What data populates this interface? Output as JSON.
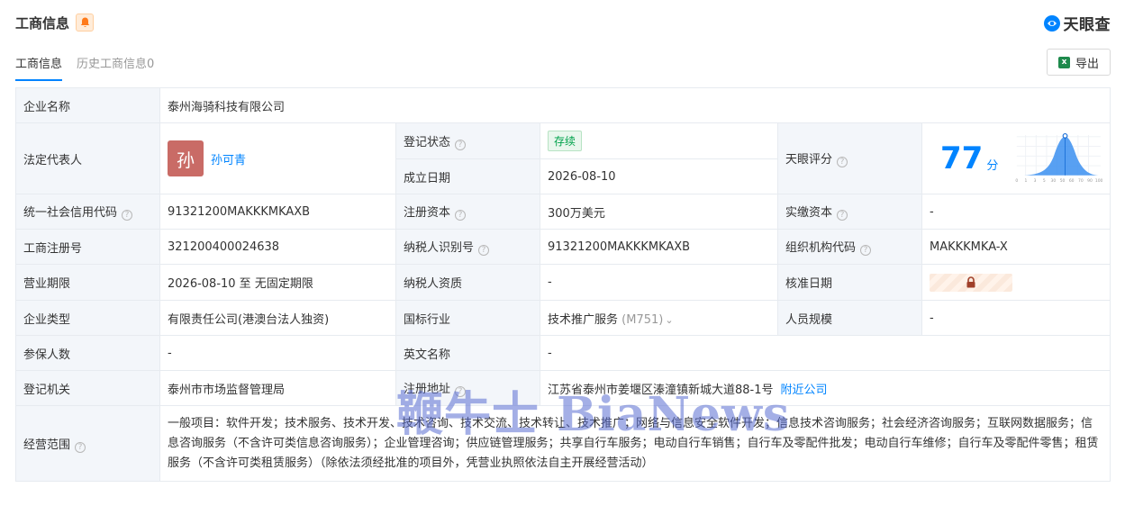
{
  "header": {
    "title": "工商信息",
    "logo_text": "天眼查"
  },
  "tabs": [
    {
      "label": "工商信息"
    },
    {
      "label": "历史工商信息0"
    }
  ],
  "export_label": "导出",
  "rows": {
    "company_name": {
      "label": "企业名称",
      "value": "泰州海骑科技有限公司"
    },
    "legal_rep": {
      "label": "法定代表人",
      "avatar_char": "孙",
      "name": "孙可青"
    },
    "reg_status": {
      "label": "登记状态",
      "value": "存续"
    },
    "founded": {
      "label": "成立日期",
      "value": "2026-08-10"
    },
    "score": {
      "label": "天眼评分",
      "value": "77",
      "unit": "分",
      "axis_ticks": [
        "0",
        "1",
        "3",
        "5",
        "30",
        "50",
        "60",
        "70",
        "90",
        "100"
      ]
    },
    "credit_code": {
      "label": "统一社会信用代码",
      "value": "91321200MAKKKMKAXB"
    },
    "reg_capital": {
      "label": "注册资本",
      "value": "300万美元"
    },
    "paid_capital": {
      "label": "实缴资本",
      "value": "-"
    },
    "reg_no": {
      "label": "工商注册号",
      "value": "321200400024638"
    },
    "taxpayer_id": {
      "label": "纳税人识别号",
      "value": "91321200MAKKKMKAXB"
    },
    "org_code": {
      "label": "组织机构代码",
      "value": "MAKKKMKA-X"
    },
    "term": {
      "label": "营业期限",
      "value": "2026-08-10 至 无固定期限"
    },
    "taxpayer_qual": {
      "label": "纳税人资质",
      "value": "-"
    },
    "approval_date": {
      "label": "核准日期"
    },
    "company_type": {
      "label": "企业类型",
      "value": "有限责任公司(港澳台法人独资)"
    },
    "industry": {
      "label": "国标行业",
      "value": "技术推广服务",
      "code": "(M751)"
    },
    "staff_size": {
      "label": "人员规模",
      "value": "-"
    },
    "insured": {
      "label": "参保人数",
      "value": "-"
    },
    "english_name": {
      "label": "英文名称",
      "value": "-"
    },
    "reg_authority": {
      "label": "登记机关",
      "value": "泰州市市场监督管理局"
    },
    "reg_address": {
      "label": "注册地址",
      "value": "江苏省泰州市姜堰区溱潼镇新城大道88-1号",
      "link": "附近公司"
    },
    "scope": {
      "label": "经营范围",
      "value": "一般项目：软件开发；技术服务、技术开发、技术咨询、技术交流、技术转让、技术推广；网络与信息安全软件开发；信息技术咨询服务；社会经济咨询服务；互联网数据服务；信息咨询服务（不含许可类信息咨询服务）；企业管理咨询；供应链管理服务；共享自行车服务；电动自行车销售；自行车及零配件批发；电动自行车维修；自行车及零配件零售；租赁服务（不含许可类租赁服务）（除依法须经批准的项目外，凭营业执照依法自主开展经营活动）"
    }
  },
  "watermark": "鞭牛士 BiaNews"
}
